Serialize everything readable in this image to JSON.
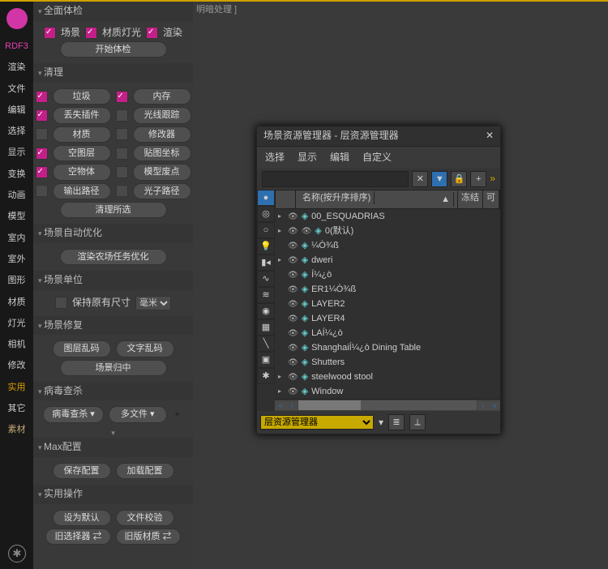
{
  "leftbar": {
    "name": "RDF3",
    "cats": [
      "渲染",
      "文件",
      "编辑",
      "选择",
      "显示",
      "变换",
      "动画",
      "模型",
      "室内",
      "室外",
      "图形",
      "材质",
      "灯光",
      "相机",
      "修改",
      "实用",
      "其它",
      "素材"
    ]
  },
  "hint": "明暗处理 ]",
  "panel": {
    "s1": {
      "t": "全面体检",
      "c1": "场景",
      "c2": "材质灯光",
      "c3": "渲染",
      "btn": "开始体检"
    },
    "s2": {
      "t": "清理",
      "items": [
        [
          "垃圾",
          "内存",
          true,
          true
        ],
        [
          "丢失插件",
          "光线跟踪",
          true,
          false
        ],
        [
          "材质",
          "修改器",
          false,
          false
        ],
        [
          "空图层",
          "贴图坐标",
          true,
          false
        ],
        [
          "空物体",
          "模型废点",
          true,
          false
        ],
        [
          "输出路径",
          "光子路径",
          false,
          false
        ]
      ],
      "btn": "清理所选"
    },
    "s3": {
      "t": "场景自动优化",
      "btn": "渲染农场任务优化"
    },
    "s4": {
      "t": "场景单位",
      "c": "保持原有尺寸",
      "sel": "毫米"
    },
    "s5": {
      "t": "场景修复",
      "b1": "图层乱码",
      "b2": "文字乱码",
      "b3": "场景归中"
    },
    "s6": {
      "t": "病毒查杀",
      "b1": "病毒查杀",
      "b2": "多文件"
    },
    "s7": {
      "t": "Max配置",
      "b1": "保存配置",
      "b2": "加载配置"
    },
    "s8": {
      "t": "实用操作",
      "b1": "设为默认",
      "b2": "文件校验",
      "b3": "旧选择器",
      "b4": "旧版材质"
    }
  },
  "dlg": {
    "title": "场景资源管理器 - 层资源管理器",
    "menu": [
      "选择",
      "显示",
      "编辑",
      "自定义"
    ],
    "hdr": {
      "name": "名称(按升序排序)",
      "frozen": "冻结",
      "vis": "可"
    },
    "rows": [
      {
        "exp": "▸",
        "n": "00_ESQUADRIAS"
      },
      {
        "exp": "▸",
        "n": "0(默认)",
        "extra": 1
      },
      {
        "exp": "",
        "n": "¼Ò¾ß"
      },
      {
        "exp": "▸",
        "n": "dweri"
      },
      {
        "exp": "",
        "n": "Í¼¿ò"
      },
      {
        "exp": "",
        "n": "ER1¼Ò¾ß"
      },
      {
        "exp": "",
        "n": "LAYER2"
      },
      {
        "exp": "",
        "n": "LAYER4"
      },
      {
        "exp": "",
        "n": "LAÍ¼¿ò"
      },
      {
        "exp": "",
        "n": "ShanghaiÍ¼¿ò Dining Table"
      },
      {
        "exp": "",
        "n": "Shutters"
      },
      {
        "exp": "▸",
        "n": "steelwood stool"
      },
      {
        "exp": "▸",
        "n": "Window"
      }
    ],
    "footer": "层资源管理器"
  }
}
